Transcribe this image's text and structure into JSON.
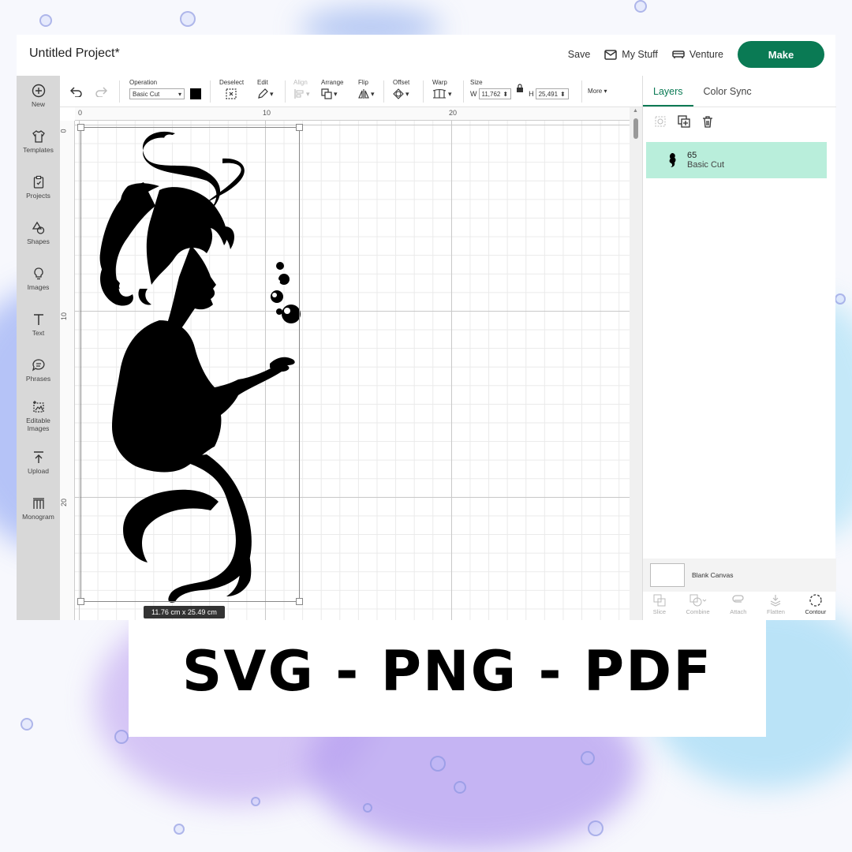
{
  "app": {
    "project_title": "Untitled Project*",
    "save_label": "Save",
    "my_stuff_label": "My Stuff",
    "venture_label": "Venture",
    "make_label": "Make",
    "accent_color": "#0a7a54"
  },
  "left_rail": {
    "items": [
      {
        "label": "New",
        "icon": "plus-circle-icon"
      },
      {
        "label": "Templates",
        "icon": "shirt-icon"
      },
      {
        "label": "Projects",
        "icon": "clipboard-icon"
      },
      {
        "label": "Shapes",
        "icon": "shapes-icon"
      },
      {
        "label": "Images",
        "icon": "lightbulb-icon"
      },
      {
        "label": "Text",
        "icon": "text-icon"
      },
      {
        "label": "Phrases",
        "icon": "speech-bubble-icon"
      },
      {
        "label": "Editable Images",
        "icon": "editable-image-icon"
      },
      {
        "label": "Upload",
        "icon": "upload-icon"
      },
      {
        "label": "Monogram",
        "icon": "monogram-icon"
      }
    ]
  },
  "toolbar": {
    "operation_label": "Operation",
    "operation_value": "Basic Cut",
    "deselect_label": "Deselect",
    "edit_label": "Edit",
    "align_label": "Align",
    "arrange_label": "Arrange",
    "flip_label": "Flip",
    "offset_label": "Offset",
    "warp_label": "Warp",
    "size_label": "Size",
    "w_label": "W",
    "w_value": "11,762",
    "h_label": "H",
    "h_value": "25,491",
    "more_label": "More"
  },
  "canvas": {
    "ruler_top": [
      "0",
      "10",
      "20"
    ],
    "ruler_left": [
      "0",
      "10",
      "20"
    ],
    "dimensions_tag": "11.76  cm x 25.49  cm"
  },
  "right_panel": {
    "tab_layers": "Layers",
    "tab_color_sync": "Color Sync",
    "layer": {
      "name": "65",
      "operation": "Basic Cut",
      "color": "#b9eedb"
    },
    "blank_canvas_label": "Blank Canvas",
    "bottom_tools": [
      {
        "label": "Slice",
        "icon": "slice-icon",
        "enabled": false
      },
      {
        "label": "Combine",
        "icon": "combine-icon",
        "enabled": false
      },
      {
        "label": "Attach",
        "icon": "attach-icon",
        "enabled": false
      },
      {
        "label": "Flatten",
        "icon": "flatten-icon",
        "enabled": false
      },
      {
        "label": "Contour",
        "icon": "contour-icon",
        "enabled": true
      }
    ]
  },
  "banner": {
    "text": "SVG - PNG - PDF"
  }
}
